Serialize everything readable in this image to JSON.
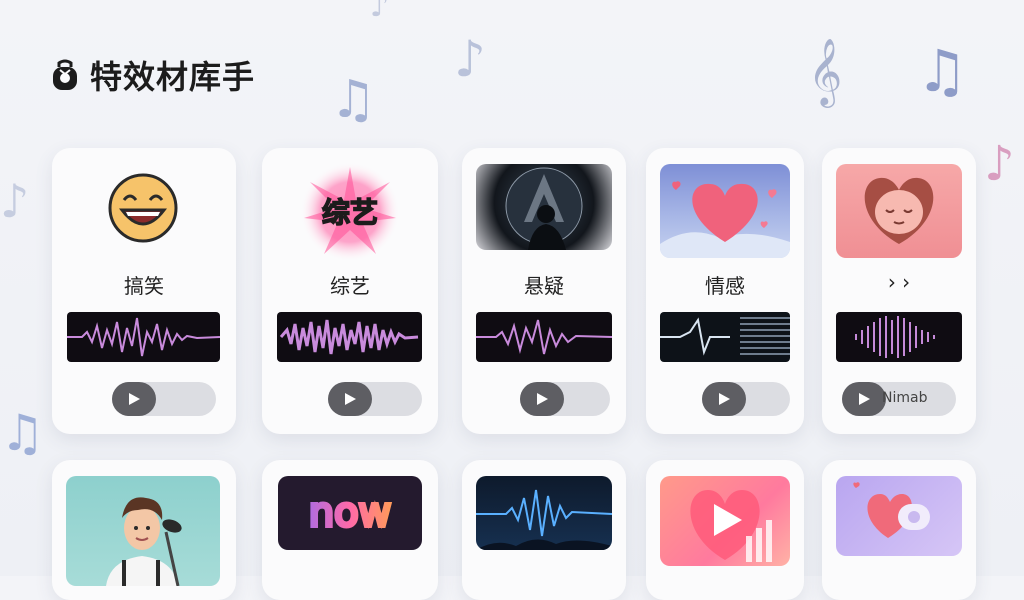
{
  "header": {
    "title": "特效材库手",
    "logo_icon": "bag-icon"
  },
  "categories": [
    {
      "label": "搞笑",
      "thumb_icon": "laughing-face-icon"
    },
    {
      "label": "综艺",
      "thumb_icon": "starburst-variety-icon",
      "thumb_text": "综艺"
    },
    {
      "label": "悬疑",
      "thumb_icon": "silhouette-mystery-icon"
    },
    {
      "label": "情感",
      "thumb_icon": "heart-icon"
    },
    {
      "label": "› ›",
      "thumb_icon": "heart-face-icon",
      "player_label": "Nimab"
    }
  ],
  "second_row": [
    {
      "thumb_icon": "singer-microphone-icon"
    },
    {
      "thumb_icon": "now-neon-icon",
      "thumb_text": "now"
    },
    {
      "thumb_icon": "blue-waveform-icon"
    },
    {
      "thumb_icon": "play-heart-icon"
    },
    {
      "thumb_icon": "heart-link-icon"
    }
  ],
  "colors": {
    "accent": "#e04080",
    "wave_pink": "#c98bdc",
    "play_button": "#5e5e63"
  }
}
